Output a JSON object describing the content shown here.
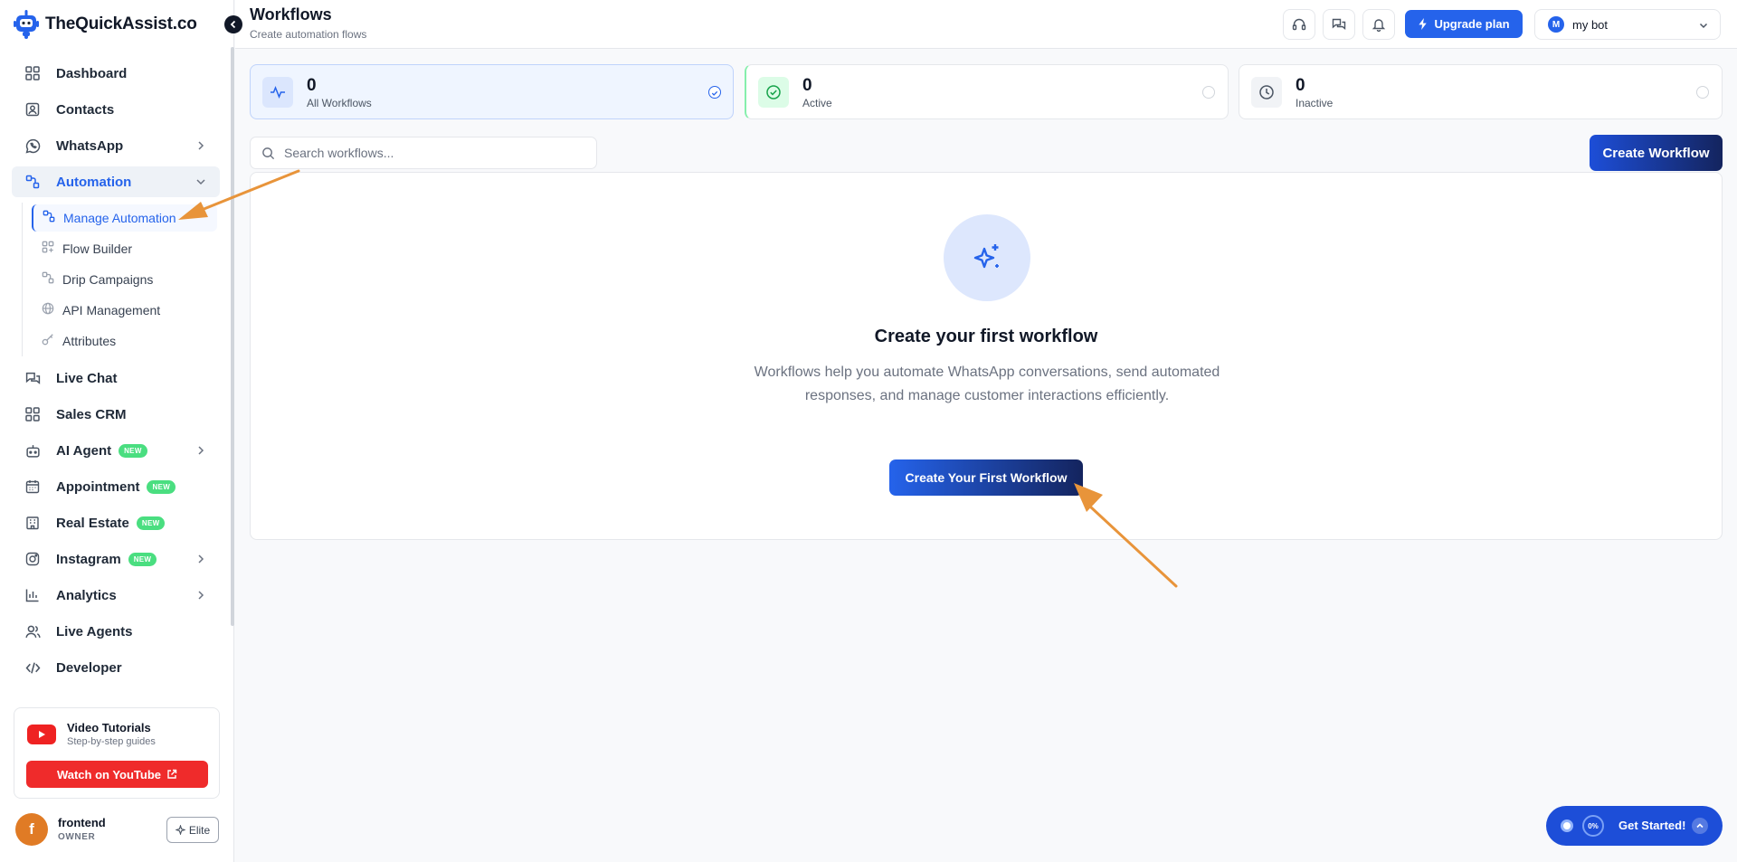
{
  "brand": {
    "name": "TheQuickAssist.co"
  },
  "sidebar": {
    "items": [
      {
        "label": "Dashboard",
        "icon": "grid-icon"
      },
      {
        "label": "Contacts",
        "icon": "contact-card-icon"
      },
      {
        "label": "WhatsApp",
        "icon": "whatsapp-icon"
      },
      {
        "label": "Automation",
        "icon": "automation-icon"
      },
      {
        "label": "Live Chat",
        "icon": "chat-icon"
      },
      {
        "label": "Sales CRM",
        "icon": "grid-icon"
      },
      {
        "label": "AI Agent",
        "icon": "bot-icon",
        "badge": "NEW"
      },
      {
        "label": "Appointment",
        "icon": "calendar-icon",
        "badge": "NEW"
      },
      {
        "label": "Real Estate",
        "icon": "building-icon",
        "badge": "NEW"
      },
      {
        "label": "Instagram",
        "icon": "instagram-icon",
        "badge": "NEW"
      },
      {
        "label": "Analytics",
        "icon": "bar-chart-icon"
      },
      {
        "label": "Live Agents",
        "icon": "users-icon"
      },
      {
        "label": "Developer",
        "icon": "code-icon"
      }
    ],
    "subitems": [
      {
        "label": "Manage Automation"
      },
      {
        "label": "Flow Builder"
      },
      {
        "label": "Drip Campaigns"
      },
      {
        "label": "API Management"
      },
      {
        "label": "Attributes"
      }
    ]
  },
  "video": {
    "title": "Video Tutorials",
    "subtitle": "Step-by-step guides",
    "button": "Watch on YouTube"
  },
  "user": {
    "initial": "f",
    "name": "frontend",
    "role": "OWNER",
    "plan": "Elite"
  },
  "header": {
    "title": "Workflows",
    "subtitle": "Create automation flows",
    "upgrade": "Upgrade plan",
    "bot_initial": "M",
    "bot_name": "my bot"
  },
  "stats": [
    {
      "value": "0",
      "label": "All Workflows"
    },
    {
      "value": "0",
      "label": "Active"
    },
    {
      "value": "0",
      "label": "Inactive"
    }
  ],
  "search": {
    "placeholder": "Search workflows...",
    "value": ""
  },
  "create_button": "Create Workflow",
  "empty": {
    "title": "Create your first workflow",
    "description": "Workflows help you automate WhatsApp conversations, send automated responses, and manage customer interactions efficiently.",
    "button": "Create Your First Workflow"
  },
  "get_started": {
    "percent": "0%",
    "label": "Get Started!"
  },
  "colors": {
    "accent": "#2563eb",
    "annotation_arrow": "#e8943a",
    "new_badge": "#4ade80",
    "youtube": "#ef2b2b"
  }
}
